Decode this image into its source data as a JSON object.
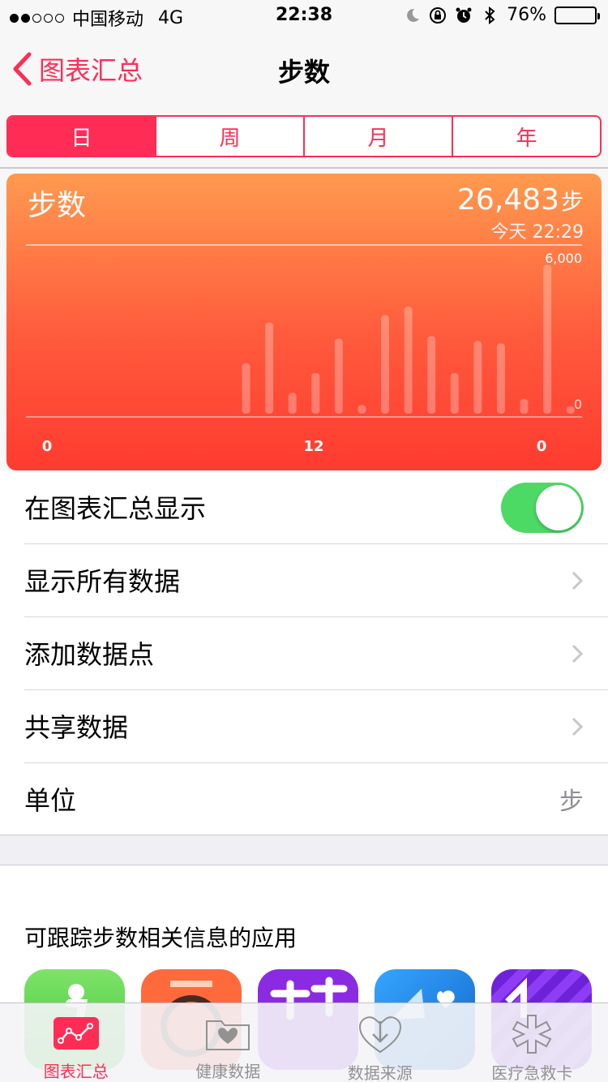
{
  "status_bar": {
    "carrier": "中国移动",
    "network": "4G",
    "time": "22:38",
    "battery": "76%",
    "battery_level": 0.76,
    "icons": [
      "moon-icon",
      "rotation-lock-icon",
      "alarm-icon",
      "bluetooth-icon",
      "battery-icon"
    ]
  },
  "nav": {
    "back_label": "图表汇总",
    "title": "步数"
  },
  "segments": {
    "items": [
      "日",
      "周",
      "月",
      "年"
    ],
    "selected": "日"
  },
  "summary": {
    "title": "步数",
    "value": "26,483",
    "unit": "步",
    "timestamp": "今天 22:29"
  },
  "chart_data": {
    "type": "bar",
    "x_tick_labels": [
      "0",
      "12",
      "0"
    ],
    "y_tick_labels": [
      "6,000",
      "0"
    ],
    "ylim": [
      0,
      6000
    ],
    "bars": [
      {
        "hour": 9,
        "value": 2050
      },
      {
        "hour": 10,
        "value": 3700
      },
      {
        "hour": 11,
        "value": 850
      },
      {
        "hour": 12,
        "value": 1650
      },
      {
        "hour": 13,
        "value": 3050
      },
      {
        "hour": 14,
        "value": 350
      },
      {
        "hour": 15,
        "value": 4000
      },
      {
        "hour": 16,
        "value": 4350
      },
      {
        "hour": 17,
        "value": 3150
      },
      {
        "hour": 18,
        "value": 1650
      },
      {
        "hour": 19,
        "value": 2950
      },
      {
        "hour": 20,
        "value": 2850
      },
      {
        "hour": 21,
        "value": 600
      },
      {
        "hour": 22,
        "value": 6050
      },
      {
        "hour": 23,
        "value": 300
      }
    ],
    "grid": true
  },
  "list": {
    "show_in_dashboard": "在图表汇总显示",
    "show_in_dashboard_on": true,
    "show_all_data": "显示所有数据",
    "add_data_point": "添加数据点",
    "share_data": "共享数据",
    "unit_label": "单位",
    "unit_value": "步"
  },
  "apps": {
    "title": "可跟踪步数相关信息的应用",
    "items": [
      {
        "name": "app-green",
        "color": "#4cd964"
      },
      {
        "name": "app-orange",
        "color": "#ff6a3d"
      },
      {
        "name": "app-purple",
        "color": "#8a2be2"
      },
      {
        "name": "app-blue",
        "color": "#1d82e0"
      },
      {
        "name": "app-violet",
        "color": "#7b2ff2"
      }
    ]
  },
  "tabbar": {
    "items": [
      {
        "label": "图表汇总",
        "icon": "dashboard-icon",
        "active": true
      },
      {
        "label": "健康数据",
        "icon": "health-data-icon",
        "active": false
      },
      {
        "label": "数据来源",
        "icon": "sources-icon",
        "active": false
      },
      {
        "label": "医疗急救卡",
        "icon": "medical-id-icon",
        "active": false
      }
    ]
  },
  "colors": {
    "accent": "#ff2d55",
    "card_top": "#ff9a4f",
    "card_bottom": "#ff3b30",
    "toggle_on": "#4cd964"
  }
}
